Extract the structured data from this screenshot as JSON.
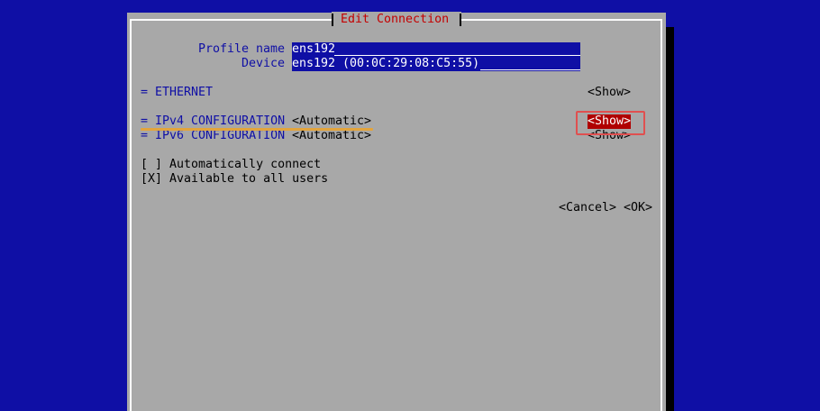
{
  "dialog": {
    "title": "Edit Connection",
    "profile_name_label": "Profile name",
    "profile_name_value": "ens192",
    "device_label": "Device",
    "device_value": "ens192 (00:0C:29:08:C5:55)",
    "ethernet": {
      "label": "= ETHERNET",
      "action": "<Show>"
    },
    "ipv4": {
      "label": "= IPv4 CONFIGURATION",
      "method": "<Automatic>",
      "action": "<Show>"
    },
    "ipv6": {
      "label": "= IPv6 CONFIGURATION",
      "method": "<Automatic>",
      "action": "<Show>"
    },
    "auto_connect": {
      "box": "[ ]",
      "label": "Automatically connect"
    },
    "all_users": {
      "box": "[X]",
      "label": "Available to all users"
    },
    "cancel_label": "<Cancel>",
    "ok_label": "<OK>"
  },
  "colors": {
    "background": "#0f0fa5",
    "dialog": "#a8a8a8",
    "title": "#c40000",
    "focus": "#b00000",
    "annotation_box": "#e05050",
    "annotation_underline": "#e3a43c"
  }
}
